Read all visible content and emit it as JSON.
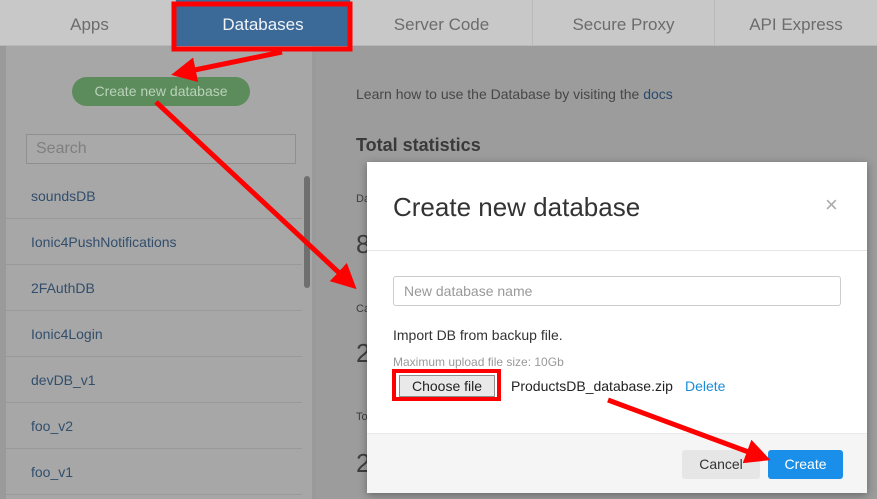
{
  "tabs": [
    "Apps",
    "Databases",
    "Server Code",
    "Secure Proxy",
    "API Express"
  ],
  "sidebar": {
    "create_label": "Create new database",
    "search_placeholder": "Search",
    "databases": [
      "soundsDB",
      "Ionic4PushNotifications",
      "2FAuthDB",
      "Ionic4Login",
      "devDB_v1",
      "foo_v2",
      "foo_v1"
    ]
  },
  "main": {
    "learn_text": "Learn how to use the Database by visiting the",
    "docs_link": "docs",
    "total_label": "Total statistics",
    "fragments": [
      "Da",
      "8",
      "Ca",
      "2",
      "To",
      "2"
    ]
  },
  "modal": {
    "title": "Create new database",
    "close_glyph": "×",
    "name_placeholder": "New database name",
    "import_label": "Import DB from backup file.",
    "upload_limit": "Maximum upload file size: 10Gb",
    "choose_file_label": "Choose file",
    "file_name": "ProductsDB_database.zip",
    "delete_label": "Delete",
    "cancel_label": "Cancel",
    "create_label": "Create"
  },
  "colors": {
    "accent_blue": "#1a8fe9",
    "annotation_red": "#ff0000",
    "active_tab": "#3c6a98",
    "create_green": "#5c8c5c"
  }
}
